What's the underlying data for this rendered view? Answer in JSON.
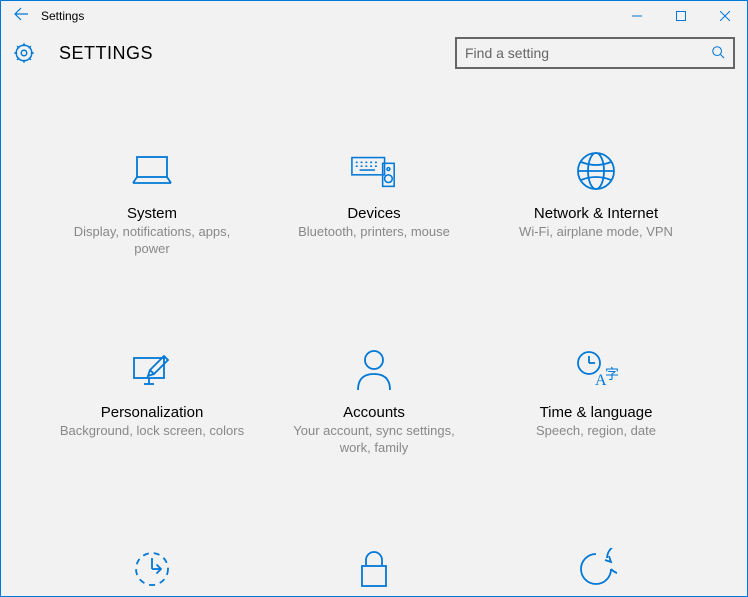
{
  "window": {
    "title": "Settings"
  },
  "header": {
    "page_title": "SETTINGS"
  },
  "search": {
    "placeholder": "Find a setting"
  },
  "tiles": {
    "system": {
      "title": "System",
      "desc": "Display, notifications, apps, power"
    },
    "devices": {
      "title": "Devices",
      "desc": "Bluetooth, printers, mouse"
    },
    "network": {
      "title": "Network & Internet",
      "desc": "Wi-Fi, airplane mode, VPN"
    },
    "personalization": {
      "title": "Personalization",
      "desc": "Background, lock screen, colors"
    },
    "accounts": {
      "title": "Accounts",
      "desc": "Your account, sync settings, work, family"
    },
    "time": {
      "title": "Time & language",
      "desc": "Speech, region, date"
    }
  }
}
